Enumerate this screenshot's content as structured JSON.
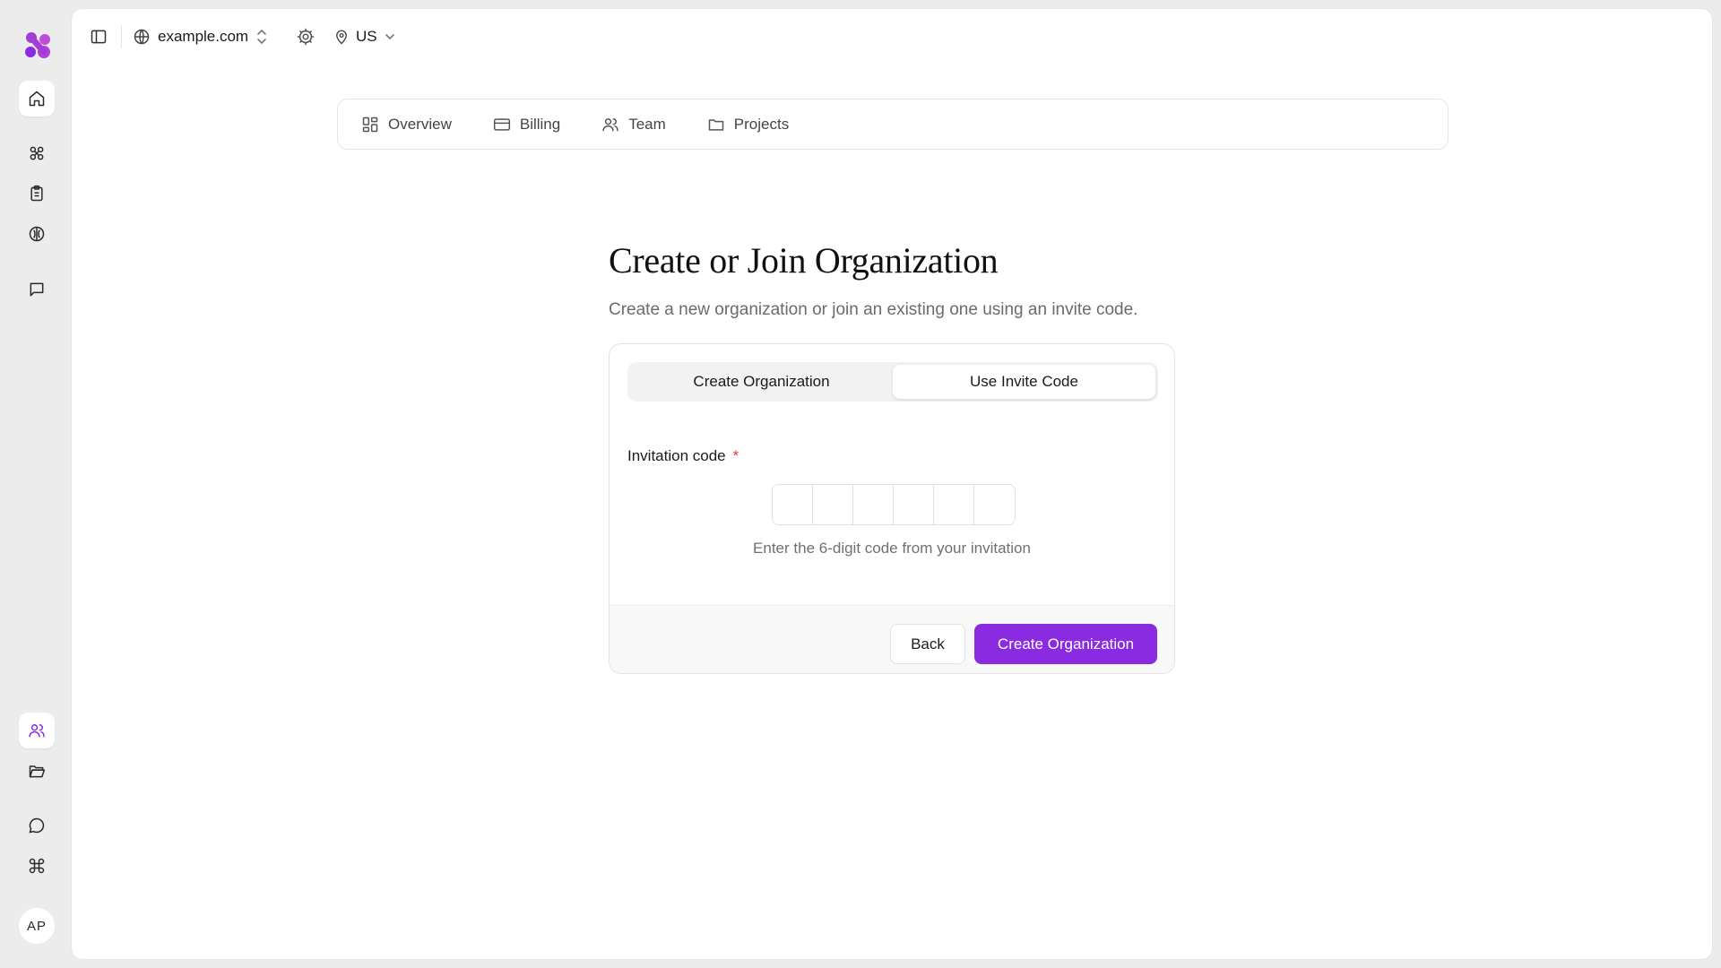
{
  "rail": {
    "icons": [
      "logo-icon",
      "home-icon",
      "network-icon",
      "clipboard-icon",
      "globe-brain-icon",
      "message-square-icon",
      "users-icon",
      "folder-open-icon",
      "message-circle-icon",
      "command-icon"
    ],
    "avatar_initials": "AP"
  },
  "topbar": {
    "domain": "example.com",
    "region": "US"
  },
  "nav": {
    "tabs": [
      {
        "label": "Overview",
        "icon": "layout-grid-icon"
      },
      {
        "label": "Billing",
        "icon": "credit-card-icon"
      },
      {
        "label": "Team",
        "icon": "users-icon"
      },
      {
        "label": "Projects",
        "icon": "folder-icon"
      }
    ]
  },
  "main": {
    "title": "Create or Join Organization",
    "subtitle": "Create a new organization or join an existing one using an invite code.",
    "segment": {
      "options": [
        "Create Organization",
        "Use Invite Code"
      ],
      "selected": "Use Invite Code"
    },
    "field_label": "Invitation code",
    "required_mark": "*",
    "code_digits": [
      "",
      "",
      "",
      "",
      "",
      ""
    ],
    "hint": "Enter the 6-digit code from your invitation",
    "back_label": "Back",
    "submit_label": "Create Organization"
  },
  "colors": {
    "accent": "#8a2be2",
    "required": "#e53935",
    "background": "#ececec"
  }
}
